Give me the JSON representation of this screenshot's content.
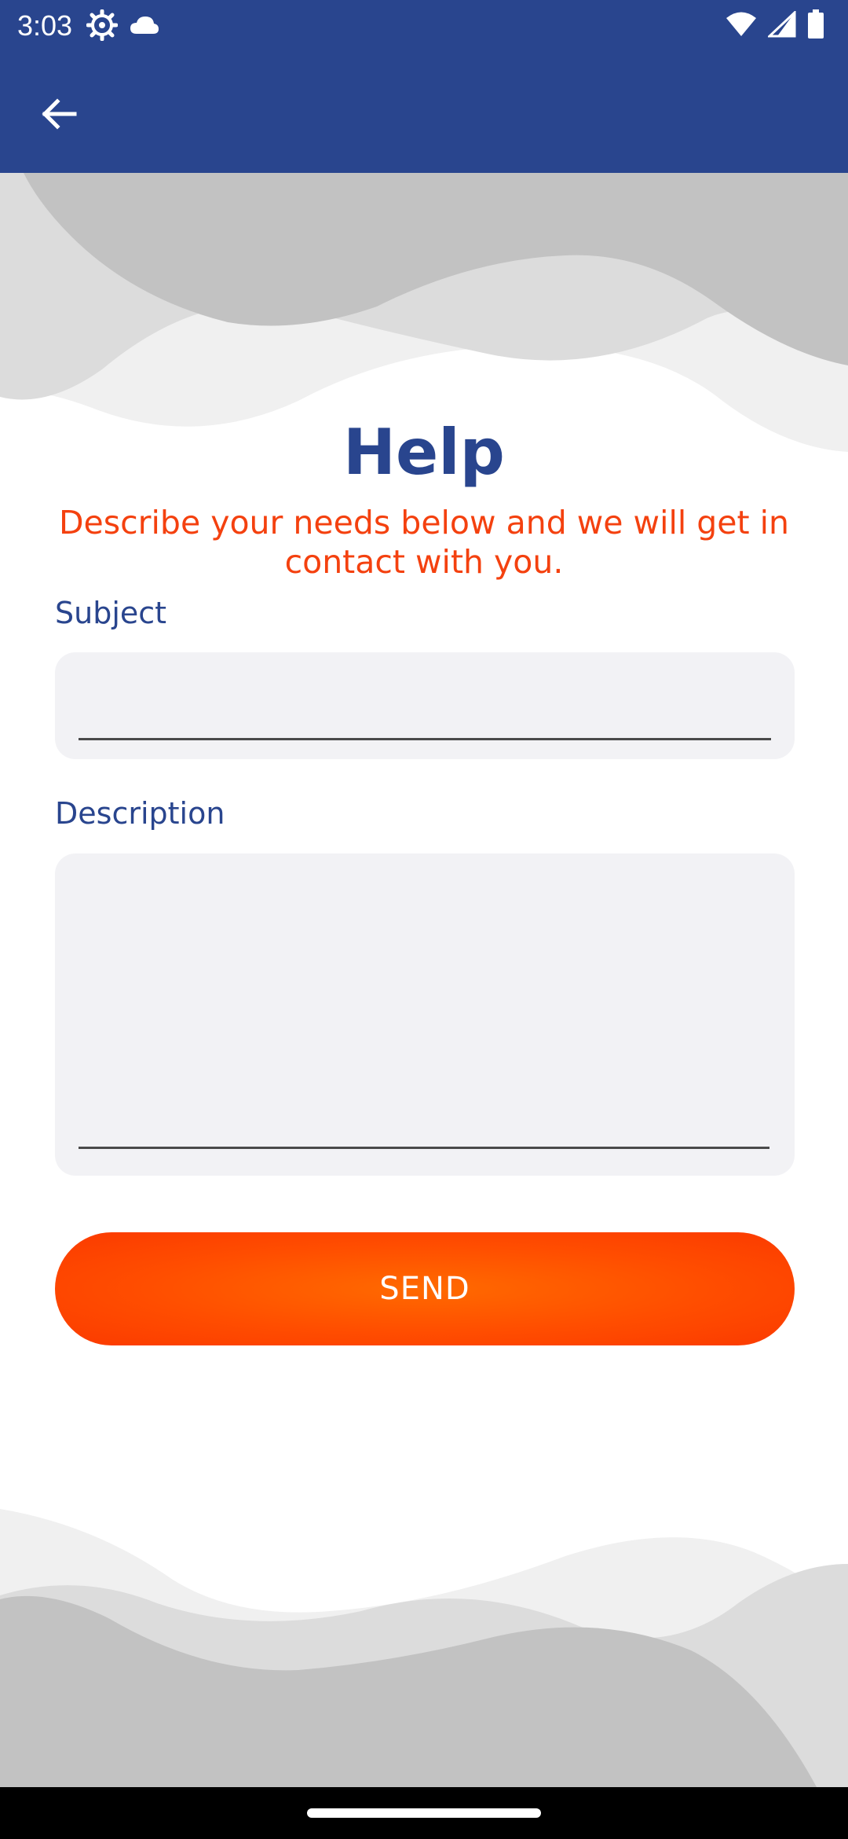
{
  "status_bar": {
    "time": "3:03",
    "left_icons": [
      "gear-icon",
      "cloud-icon"
    ],
    "right_icons": [
      "wifi-icon",
      "signal-icon",
      "battery-icon"
    ]
  },
  "app_bar": {
    "back_icon": "arrow-back-icon"
  },
  "page": {
    "title": "Help",
    "subtitle": "Describe your needs below and we will get in contact with you."
  },
  "form": {
    "subject_label": "Subject",
    "subject_value": "",
    "description_label": "Description",
    "description_value": "",
    "send_label": "SEND"
  },
  "colors": {
    "primary": "#29458e",
    "accent": "#f4410f",
    "button": "#ff5000",
    "field_bg": "#f2f2f5"
  }
}
